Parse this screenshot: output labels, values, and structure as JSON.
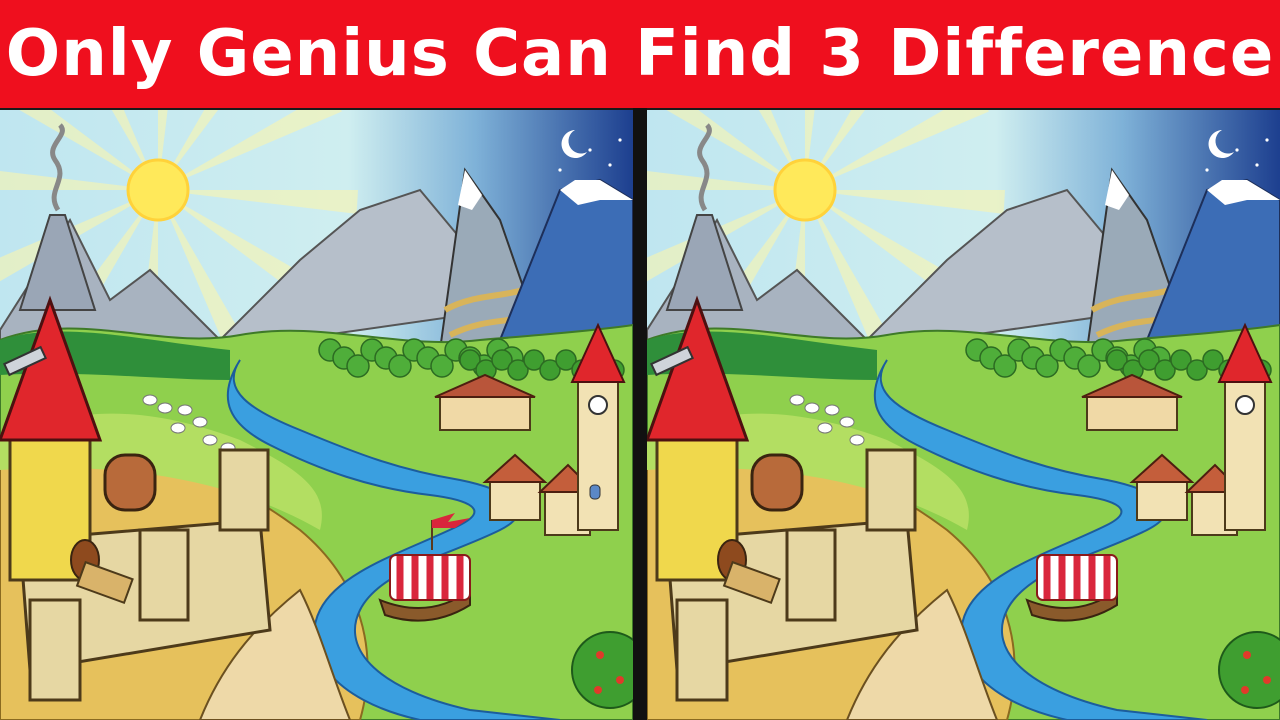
{
  "banner": {
    "title": "Only Genius Can Find 3 Difference",
    "bg_color": "#ef0f1e",
    "text_color": "#ffffff"
  },
  "divider": {
    "color": "#111111"
  },
  "puzzle": {
    "panels": [
      {
        "id": "left",
        "variant": "original"
      },
      {
        "id": "right",
        "variant": "modified"
      }
    ]
  }
}
